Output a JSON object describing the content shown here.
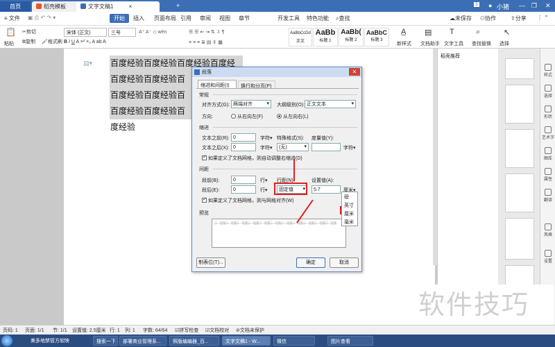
{
  "tabs": {
    "home": "首页",
    "template": "稻壳模板",
    "document": "文字文稿1",
    "add": "+"
  },
  "window": {
    "user": "小猪",
    "badge": "1"
  },
  "menu": {
    "file": "文件",
    "items": [
      "开始",
      "插入",
      "页面布局",
      "引用",
      "审阅",
      "视图",
      "章节",
      "开发工具",
      "特色功能"
    ],
    "search": "查找",
    "unsaved": "未保存",
    "collab": "协作",
    "share": "分享"
  },
  "ribbon": {
    "paste": "粘贴",
    "cut": "剪切",
    "copy": "复制",
    "format_painter": "格式刷",
    "font_name": "宋体 (正文)",
    "font_size": "三号",
    "styles": [
      {
        "preview": "AaBbCcDd",
        "name": "正文"
      },
      {
        "preview": "AaBb",
        "name": "标题 1"
      },
      {
        "preview": "AaBb(",
        "name": "标题 2"
      },
      {
        "preview": "AaBbC",
        "name": "标题 3"
      }
    ],
    "new_style": "新样式",
    "doc_helper": "文档助手",
    "text_tools": "文字工具",
    "find_replace": "查找替换",
    "select": "选择"
  },
  "document": {
    "lines": [
      "百度经验百度经验百度经验百度经验",
      "百度经验百度经验百度经验",
      "百度经验百度经验百度经验",
      "百度经验百度经验百度经验"
    ]
  },
  "right_panel": {
    "title": "稻壳推荐"
  },
  "sidebar": [
    "样式",
    "选择",
    "形状",
    "艺术字",
    "图库",
    "属性",
    "翻译",
    "风格",
    "设置"
  ],
  "dialog": {
    "title": "段落",
    "tab_indent": "缩进和间距(I)",
    "tab_breaks": "换行和分页(P)",
    "general": "常规",
    "alignment_label": "对齐方式(G):",
    "alignment_value": "两端对齐",
    "outline_label": "大纲级别(O):",
    "outline_value": "正文文本",
    "direction_label": "方向:",
    "rtl": "从右向左(F)",
    "ltr": "从左向右(L)",
    "indent": "缩进",
    "before_text_label": "文本之前(R):",
    "before_text_value": "0",
    "after_text_label": "文本之后(X):",
    "after_text_value": "0",
    "char_unit": "字符",
    "special_label": "特殊格式(S):",
    "special_value": "(无)",
    "measure_label": "度量值(Y):",
    "grid_indent": "如果定义了文档网格，则自动调整右缩进(D)",
    "spacing": "间距",
    "before_label": "段前(B):",
    "before_value": "0",
    "after_label": "段后(E):",
    "after_value": "0",
    "line_unit": "行",
    "line_spacing_label": "行距(N):",
    "line_spacing_value": "固定值",
    "setting_label": "设置值(A):",
    "setting_value": "5.7",
    "setting_unit": "厘米",
    "grid_align": "如果定义了文档网格，则与网格对齐(W)",
    "preview": "预览",
    "preview_text": "示一段落示一段落示一段落示一段落示一段落示一段落示一段落示一段落示一段落示一段落示一段落",
    "tabs_button": "制表位(T)...",
    "ok": "确定",
    "cancel": "取消",
    "unit_options": [
      "磅",
      "英寸",
      "厘米",
      "毫米"
    ]
  },
  "status": {
    "page": "页码: 1",
    "pages": "页面: 1/1",
    "section": "节: 1/1",
    "setting": "设置值: 2.5厘米",
    "row": "行: 1",
    "col": "列: 1",
    "words": "字数: 64/64",
    "spell": "拼写检查",
    "proof": "文档校对",
    "protect": "文档未保护"
  },
  "taskbar": [
    "美多地禁管方软映",
    "搜索一下",
    "部署商业管理系...",
    "照版编编器_百...",
    "文字文稿1 - W...",
    "微信",
    "图片查看"
  ],
  "watermark": "软件技巧",
  "colors": {
    "accent": "#3c6eb5",
    "highlight": "#e02020"
  }
}
